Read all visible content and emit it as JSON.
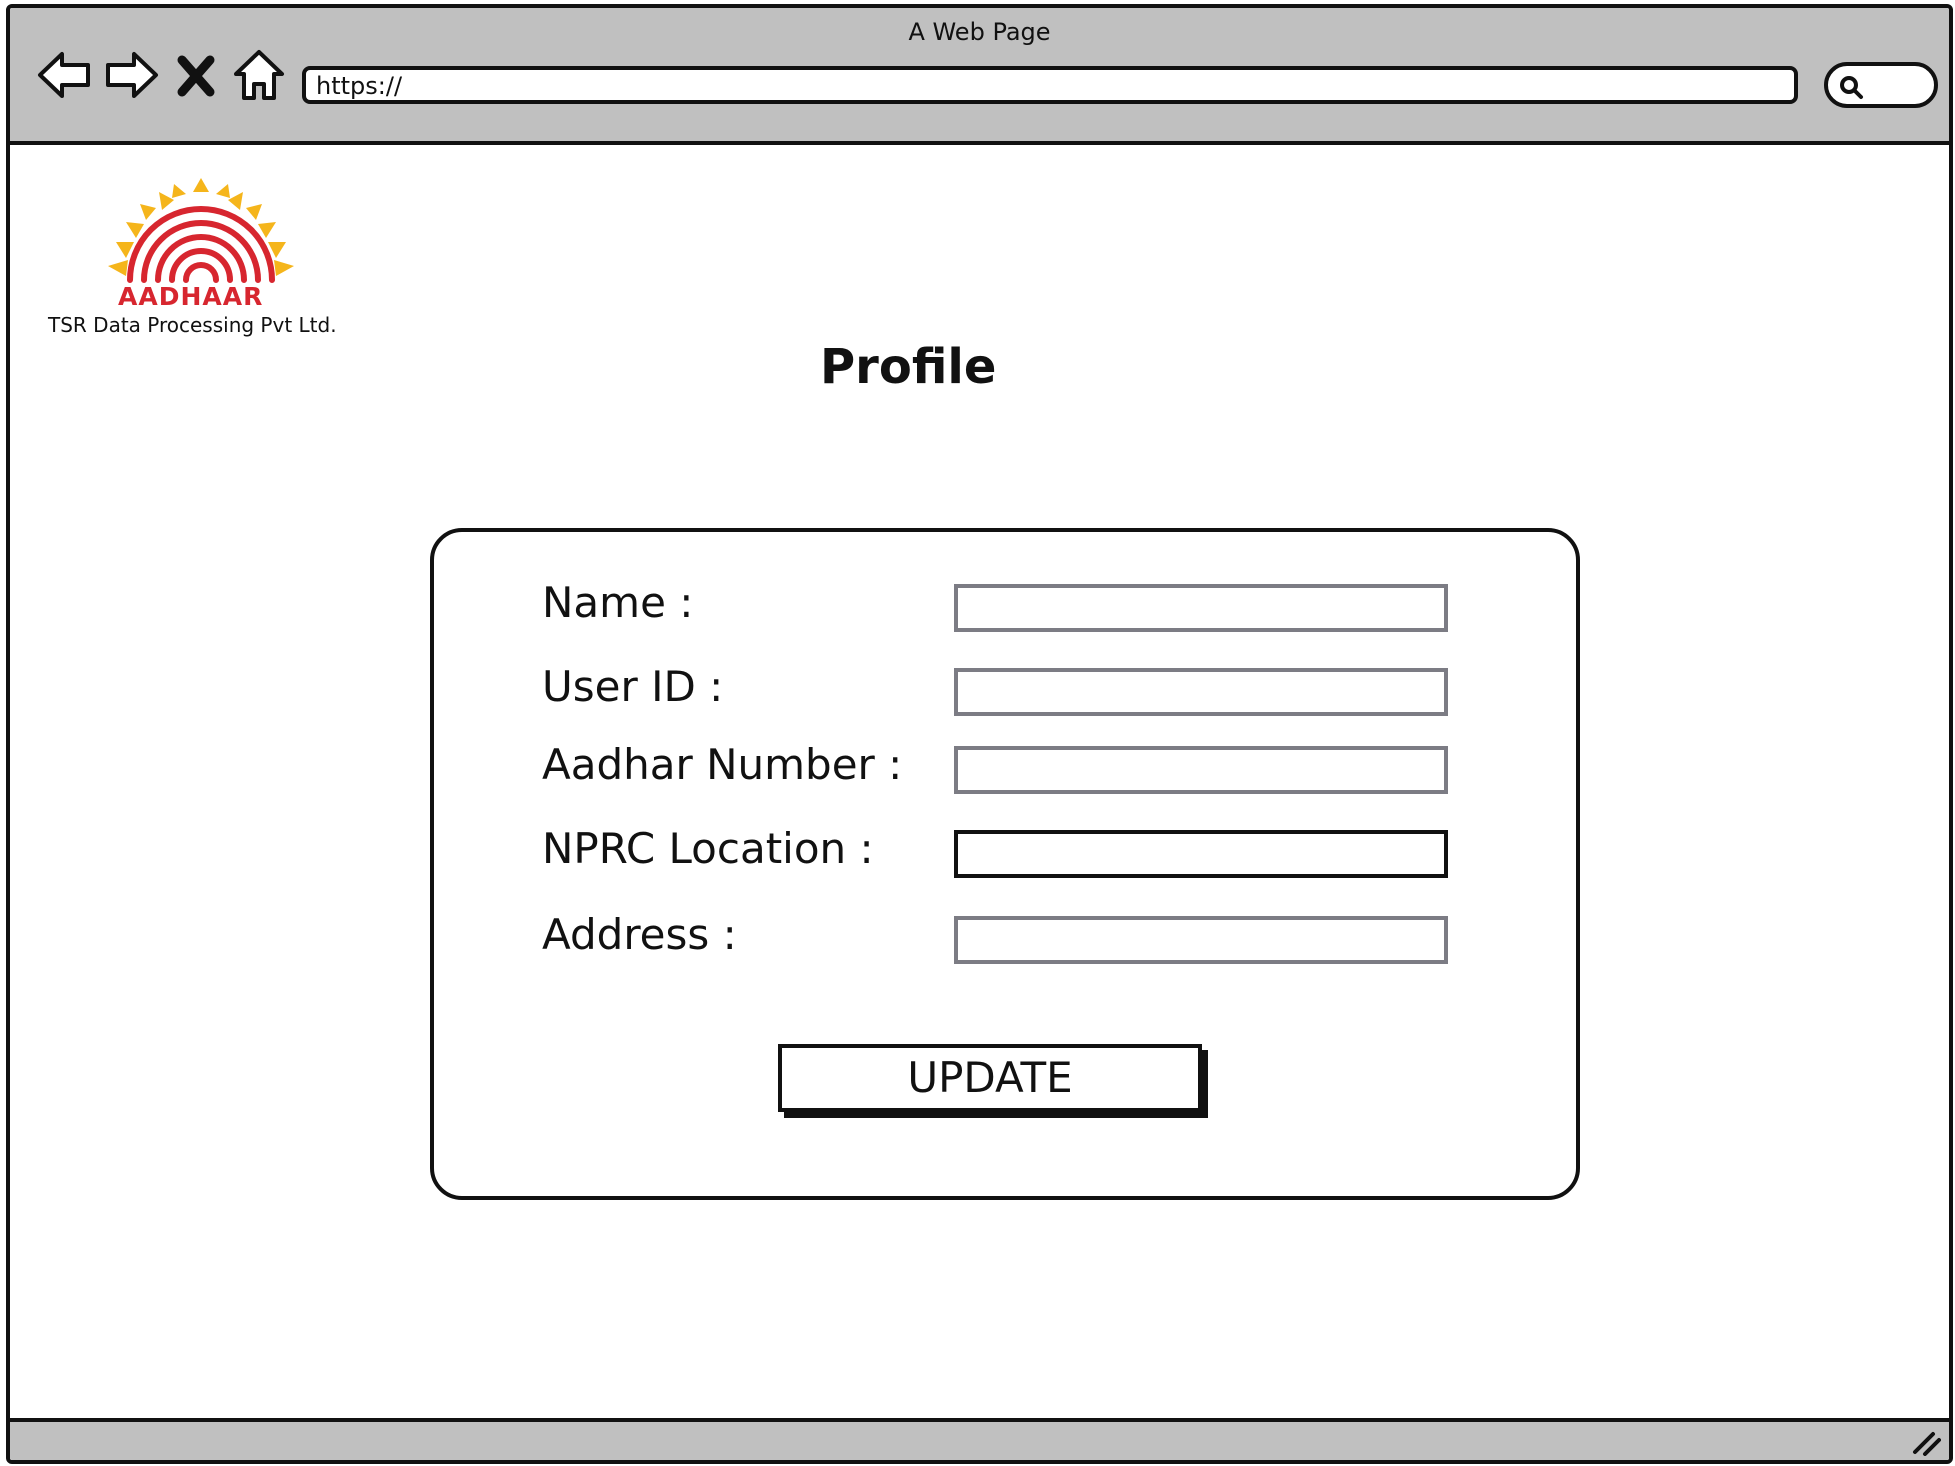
{
  "window": {
    "title": "A Web Page"
  },
  "browser": {
    "url": "https://",
    "nav_icons": [
      "back-arrow-icon",
      "forward-arrow-icon",
      "close-icon",
      "home-icon"
    ],
    "search_icon": "search-icon"
  },
  "branding": {
    "logo_text": "AADHAAR",
    "org_name": "TSR Data Processing Pvt Ltd.",
    "colors": {
      "sun": "#f5b51b",
      "fingerprint": "#d7262f"
    }
  },
  "page": {
    "title": "Profile"
  },
  "form": {
    "fields": [
      {
        "label": "Name :",
        "value": ""
      },
      {
        "label": "User ID :",
        "value": ""
      },
      {
        "label": "Aadhar Number :",
        "value": ""
      },
      {
        "label": "NPRC Location :",
        "value": ""
      },
      {
        "label": "Address :",
        "value": ""
      }
    ],
    "submit_label": "UPDATE"
  }
}
